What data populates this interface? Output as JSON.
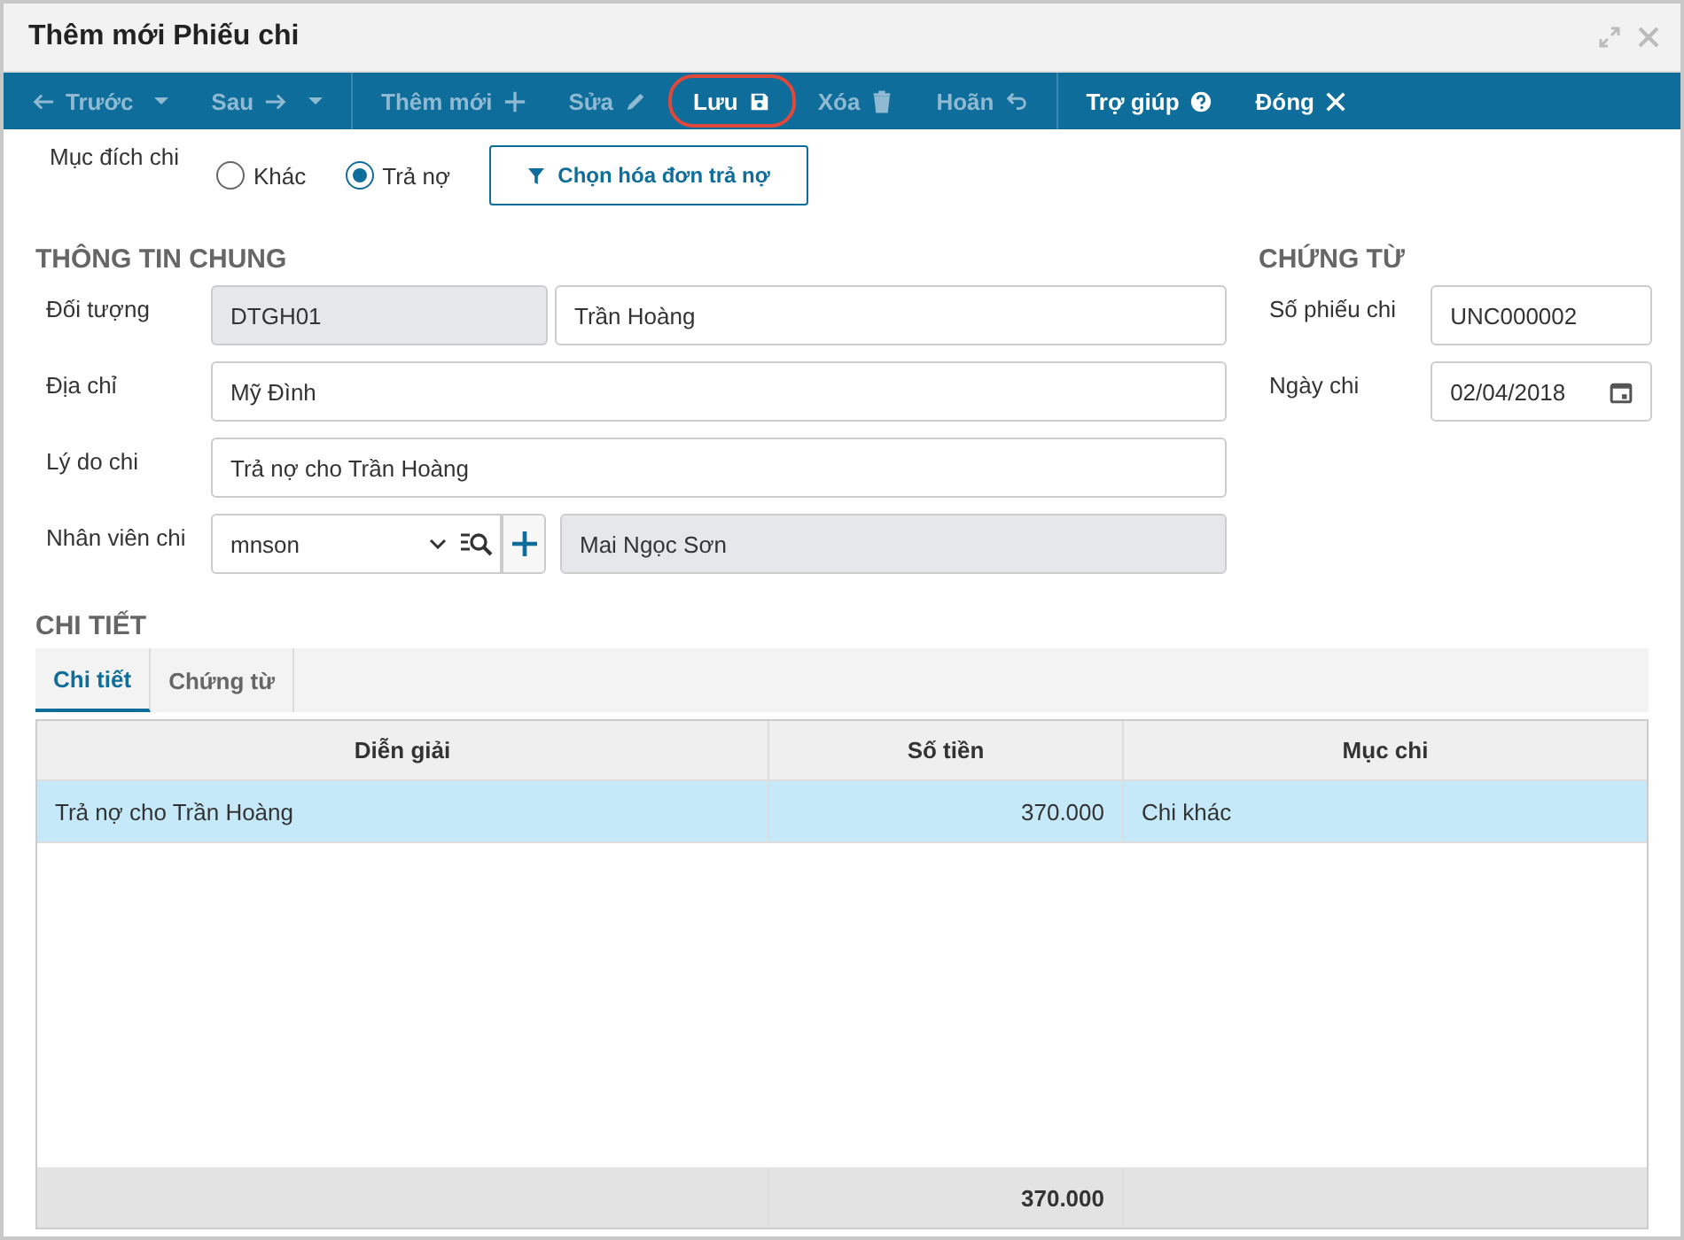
{
  "window": {
    "title": "Thêm mới Phiếu chi"
  },
  "toolbar": [
    {
      "label": "Trước",
      "disabled": true
    },
    {
      "label": "Sau",
      "disabled": true
    },
    {
      "label": "Thêm mới",
      "disabled": true
    },
    {
      "label": "Sửa",
      "disabled": true
    },
    {
      "label": "Lưu",
      "disabled": false,
      "highlighted": true
    },
    {
      "label": "Xóa",
      "disabled": true
    },
    {
      "label": "Hoãn",
      "disabled": true
    },
    {
      "label": "Trợ giúp",
      "disabled": false
    },
    {
      "label": "Đóng",
      "disabled": false
    }
  ],
  "purpose": {
    "label": "Mục đích chi",
    "options": [
      {
        "label": "Khác",
        "selected": false
      },
      {
        "label": "Trả nợ",
        "selected": true
      }
    ],
    "button": "Chọn hóa đơn trả nợ"
  },
  "general": {
    "title": "THÔNG TIN CHUNG",
    "doi_tuong": {
      "label": "Đối tượng",
      "code": "DTGH01",
      "name": "Trần Hoàng"
    },
    "dia_chi": {
      "label": "Địa chỉ",
      "value": "Mỹ Đình"
    },
    "ly_do": {
      "label": "Lý do chi",
      "value": "Trả nợ cho Trần Hoàng"
    },
    "nhan_vien": {
      "label": "Nhân viên chi",
      "code": "mnson",
      "name": "Mai Ngọc Sơn"
    }
  },
  "voucher": {
    "title": "CHỨNG TỪ",
    "number": {
      "label": "Số phiếu chi",
      "value": "UNC000002"
    },
    "date": {
      "label": "Ngày chi",
      "value": "02/04/2018"
    }
  },
  "detail": {
    "title": "CHI TIẾT",
    "tabs": [
      {
        "label": "Chi tiết",
        "selected": true
      },
      {
        "label": "Chứng từ",
        "selected": false
      }
    ],
    "table": {
      "columns": [
        "Diễn giải",
        "Số tiền",
        "Mục chi"
      ],
      "rows": [
        {
          "cells": [
            "Trả nợ cho Trần Hoàng",
            "370.000",
            "Chi khác"
          ],
          "selected": true
        }
      ],
      "footer": {
        "total": "370.000"
      }
    }
  }
}
